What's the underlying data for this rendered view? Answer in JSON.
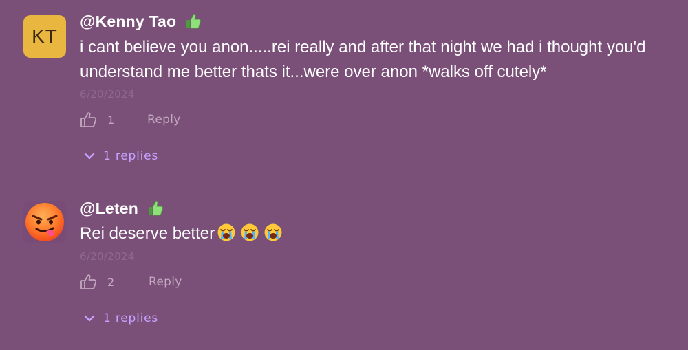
{
  "comments": [
    {
      "avatar_initials": "KT",
      "avatar_color": "#e9b640",
      "username": "@Kenny Tao",
      "badge_icon": "thumbs-up-emoji",
      "text": "i cant believe you anon.....rei really and after that night we had i thought you'd understand me better thats it...were over anon *walks off cutely*",
      "date": "6/20/2024",
      "likes": "1",
      "reply_label": "Reply",
      "replies_label": "1 replies"
    },
    {
      "avatar_icon": "devil-tongue-emoji",
      "username": "@Leten",
      "badge_icon": "thumbs-up-emoji",
      "text": "Rei deserve better",
      "text_emojis": [
        "loudly-crying-face",
        "loudly-crying-face",
        "loudly-crying-face"
      ],
      "date": "6/20/2024",
      "likes": "2",
      "reply_label": "Reply",
      "replies_label": "1 replies"
    }
  ],
  "colors": {
    "background": "#7a4f78",
    "date_text": "#8f6a8d",
    "action_text": "#c3a8c0",
    "replies_accent": "#c7a2ff"
  }
}
